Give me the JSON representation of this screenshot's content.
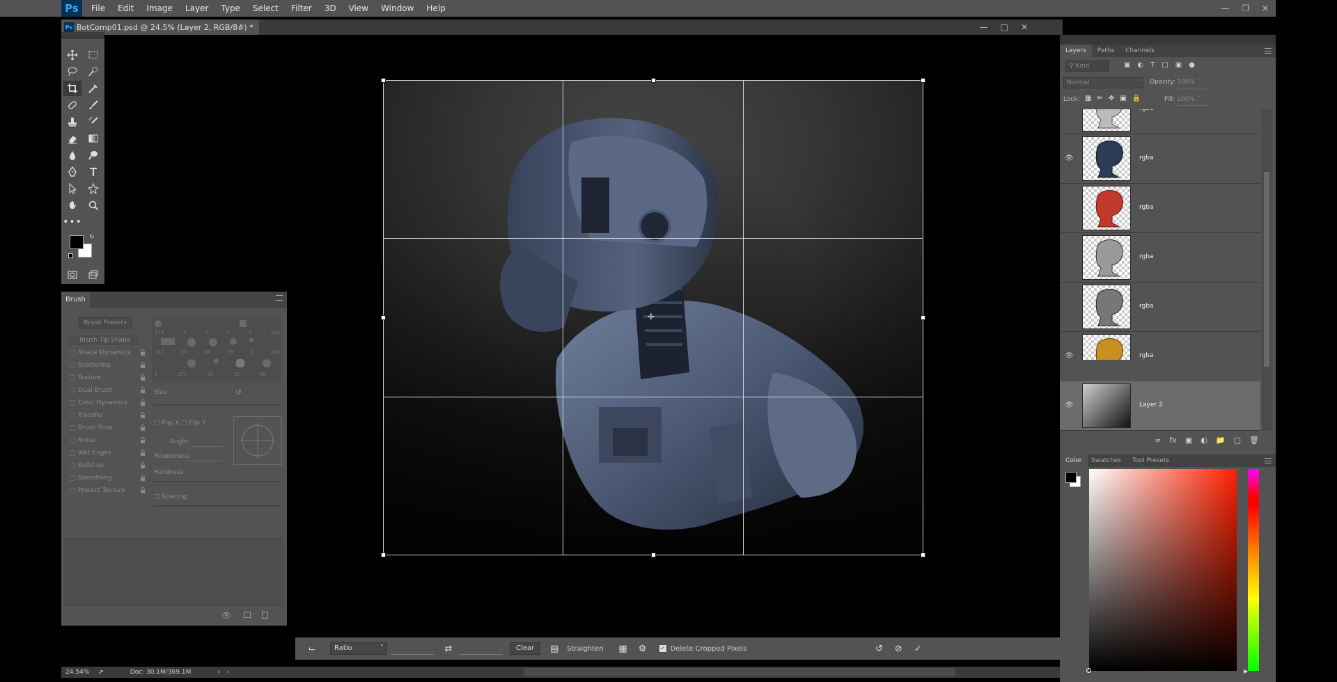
{
  "menubar": {
    "logo": "Ps",
    "items": [
      "File",
      "Edit",
      "Image",
      "Layer",
      "Type",
      "Select",
      "Filter",
      "3D",
      "View",
      "Window",
      "Help"
    ]
  },
  "document": {
    "tab_title": "BotComp01.psd @ 24.5% (Layer 2, RGB/8#) *"
  },
  "brush_panel": {
    "title": "Brush",
    "presets_button": "Brush Presets",
    "tip_shape": "Brush Tip Shape",
    "options": [
      "Shape Dynamics",
      "Scattering",
      "Texture",
      "Dual Brush",
      "Color Dynamics",
      "Transfer",
      "Brush Pose",
      "Noise",
      "Wet Edges",
      "Build-up",
      "Smoothing",
      "Protect Texture"
    ],
    "tip_sizes_row1": [
      "514",
      "3",
      "3",
      "1",
      "1",
      "120"
    ],
    "tip_sizes_row2": [
      "122",
      "25",
      "36",
      "59",
      "1",
      "150"
    ],
    "tip_sizes_row3": [
      "1",
      "175",
      "35",
      "25",
      "50"
    ],
    "size_label": "Size",
    "flip_x": "Flip X",
    "flip_y": "Flip Y",
    "angle_label": "Angle:",
    "roundness_label": "Roundness:",
    "hardness_label": "Hardness",
    "spacing_label": "Spacing"
  },
  "options_bar": {
    "ratio_select": "Ratio",
    "clear_button": "Clear",
    "straighten_label": "Straighten",
    "delete_cropped_label": "Delete Cropped Pixels",
    "delete_cropped_checked": true
  },
  "status_bar": {
    "zoom": "24.54%",
    "doc_size": "Doc: 30.1M/369.1M"
  },
  "layers_panel": {
    "tabs": [
      "Layers",
      "Paths",
      "Channels"
    ],
    "filter_kind": "Kind",
    "blend_mode": "Normal",
    "opacity_label": "Opacity:",
    "opacity_value": "100%",
    "lock_label": "Lock:",
    "fill_label": "Fill:",
    "fill_value": "100%",
    "layers": [
      {
        "name": "rgba",
        "visible": false,
        "thumb_color": "#bcbcbc"
      },
      {
        "name": "rgba",
        "visible": true,
        "thumb_color": "#2a3c56"
      },
      {
        "name": "rgba",
        "visible": false,
        "thumb_color": "#c0392b"
      },
      {
        "name": "rgba",
        "visible": false,
        "thumb_color": "#9a9a9a"
      },
      {
        "name": "rgba",
        "visible": false,
        "thumb_color": "#777777"
      },
      {
        "name": "rgba",
        "visible": true,
        "thumb_color": "#c8901e"
      },
      {
        "name": "Layer 2",
        "visible": true,
        "selected": true,
        "thumb_color": "gradient"
      }
    ]
  },
  "color_panel": {
    "tabs": [
      "Color",
      "Swatches",
      "Tool Presets"
    ],
    "foreground": "#000000",
    "background": "#ffffff",
    "hue_color": "#ff2000"
  },
  "colors": {
    "ui_bg": "#535353",
    "ui_dark": "#3a3a3a",
    "ps_blue": "#31a8ff",
    "canvas_bg": "#000000"
  }
}
